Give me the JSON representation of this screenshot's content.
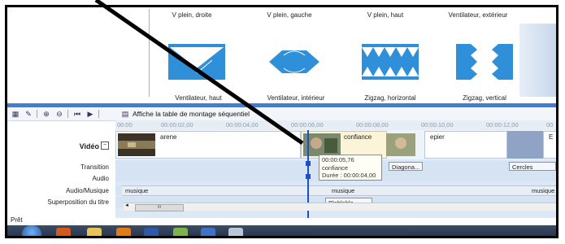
{
  "transitions": {
    "top_labels": [
      "V plein, droite",
      "V plein, gauche",
      "V plein, haut",
      "Ventilateur, extérieur"
    ],
    "bottom_labels": [
      "Ventilateur, haut",
      "Ventilateur, intérieur",
      "Zigzag, horizontal",
      "Zigzag, vertical"
    ]
  },
  "toolbar": {
    "storyboard_text": "Affiche la table de montage séquentiel"
  },
  "ruler": {
    "ticks": [
      "00:00",
      "00:00:02,00",
      "00:00:04,00",
      "00:00:06,00",
      "00:00:08,00",
      "00:00:10,00",
      "00:00:12,00",
      "00"
    ]
  },
  "tracks": {
    "labels": {
      "video": "Vidéo",
      "transition": "Transition",
      "audio": "Audio",
      "audio_music": "Audio/Musique",
      "title_overlay": "Superposition du titre"
    },
    "video_clips": [
      "arene",
      "confiance",
      "epier",
      "E"
    ],
    "transitions": [
      "Diagona...",
      "Cercles"
    ],
    "music_segments": [
      "musique",
      "musique",
      "musique"
    ],
    "title_clip": "Blablabla"
  },
  "tooltip": {
    "time": "00:00:05,76",
    "clip": "confiance",
    "duration": "Durée : 00:00:04,00"
  },
  "scrollbar": {
    "grip": "III",
    "left_arrow": "◄"
  },
  "status": {
    "text": "Prêt"
  },
  "colors": {
    "accent": "#3d7fd3",
    "playhead": "#1a4fd0",
    "transition_thumb": "#2f8fd8"
  }
}
